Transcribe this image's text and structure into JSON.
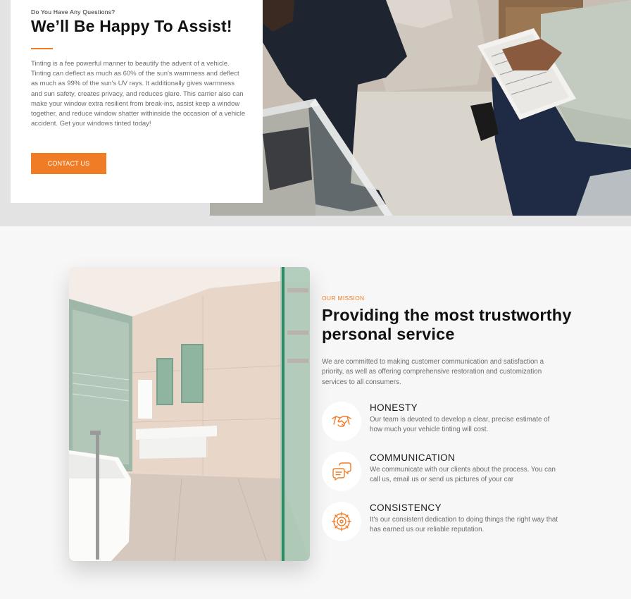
{
  "assist": {
    "eyebrow": "Do You Have Any Questions?",
    "title": "We’ll Be Happy To Assist!",
    "body": "Tinting is a fee powerful manner to beautify the advent of a vehicle. Tinting can deflect as much as 60% of the sun's warmness and deflect as much as 99% of the sun's UV rays. It additionally gives warmness and sun safety, creates privacy, and reduces glare. This carrier also can make your window extra resilient from break-ins, assist keep a window together, and reduce window shatter withinside the occasion of a vehicle accident. Get your windows tinted today!",
    "cta_label": "CONTACT US"
  },
  "mission": {
    "label": "OUR MISSION",
    "title": "Providing the most trustworthy personal service",
    "body": "We are committed to making customer communication and satisfaction a priority, as well as offering comprehensive restoration and customization services to all consumers.",
    "features": [
      {
        "icon": "handshake-icon",
        "title": "HONESTY",
        "text": "Our team is devoted to develop a clear, precise estimate of how much your vehicle tinting will cost."
      },
      {
        "icon": "chat-bubbles-icon",
        "title": "COMMUNICATION",
        "text": "We communicate with our clients about the process. You can call us, email us or send us pictures of your car"
      },
      {
        "icon": "gear-target-icon",
        "title": "CONSISTENCY",
        "text": "It's our consistent dedication to doing things the right way that has earned us our reliable reputation."
      }
    ]
  },
  "colors": {
    "accent": "#f07d26",
    "text_dark": "#111111",
    "text_muted": "#6b6b6b",
    "top_bg": "#e3e3e3",
    "section_bg": "#f7f7f7"
  }
}
